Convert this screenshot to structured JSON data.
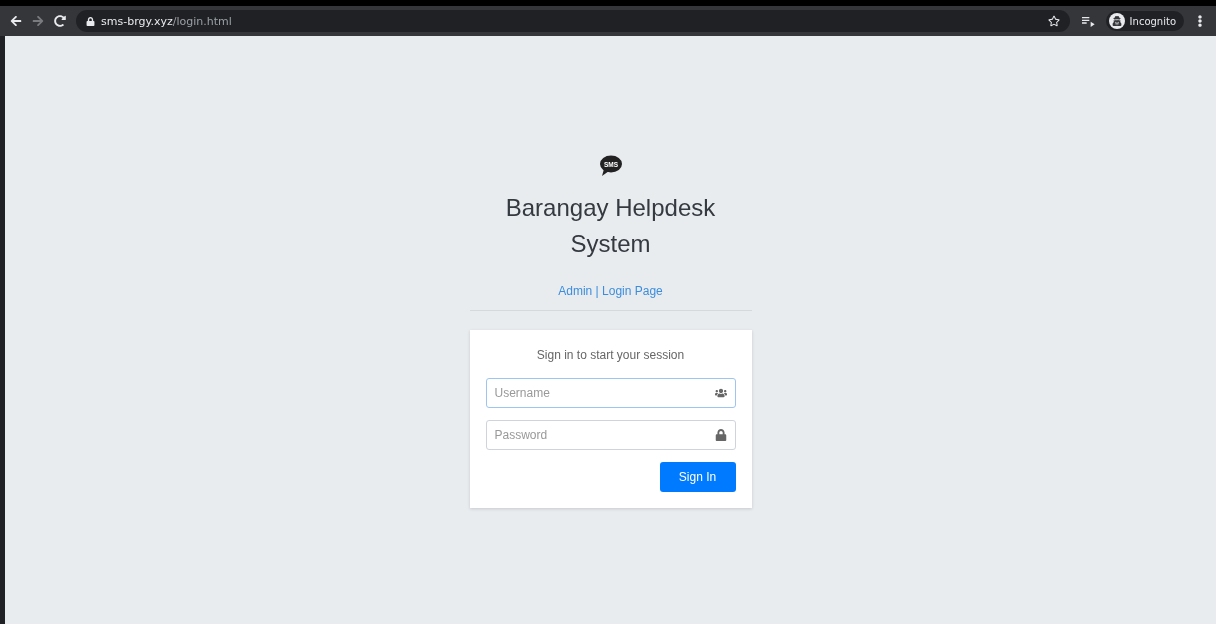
{
  "browser": {
    "url_host": "sms-brgy.xyz",
    "url_path": "/login.html",
    "profile": "Incognito"
  },
  "login": {
    "logo_text": "SMS",
    "title": "Barangay Helpdesk System",
    "subtitle": "Admin | Login Page",
    "card_title": "Sign in to start your session",
    "fields": [
      {
        "kind": "username",
        "placeholder": "Username",
        "focused": true
      },
      {
        "kind": "password",
        "placeholder": "Password",
        "focused": false
      }
    ],
    "submit": "Sign In"
  }
}
